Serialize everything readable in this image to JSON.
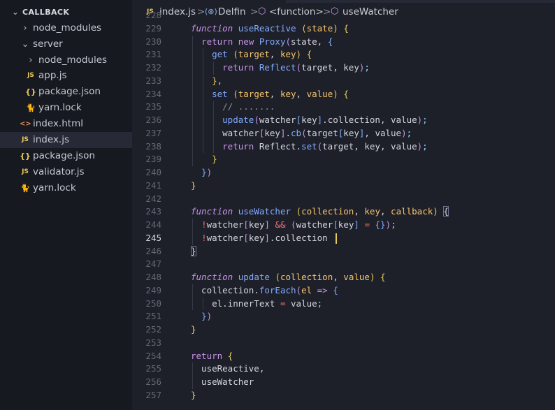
{
  "explorer": {
    "root": "CALLBACK",
    "items": [
      {
        "label": "node_modules",
        "kind": "folder",
        "depth": 1,
        "icon": "chevron-right-icon"
      },
      {
        "label": "server",
        "kind": "folder-open",
        "depth": 1,
        "icon": "chevron-down-icon"
      },
      {
        "label": "node_modules",
        "kind": "folder",
        "depth": 2,
        "icon": "chevron-right-icon"
      },
      {
        "label": "app.js",
        "kind": "js",
        "depth": 2,
        "icon": "js-file-icon"
      },
      {
        "label": "package.json",
        "kind": "json",
        "depth": 2,
        "icon": "json-file-icon"
      },
      {
        "label": "yarn.lock",
        "kind": "yarn",
        "depth": 2,
        "icon": "yarn-file-icon"
      },
      {
        "label": "index.html",
        "kind": "html",
        "depth": 1,
        "icon": "html-file-icon"
      },
      {
        "label": "index.js",
        "kind": "js",
        "depth": 1,
        "icon": "js-file-icon",
        "active": true
      },
      {
        "label": "package.json",
        "kind": "json",
        "depth": 1,
        "icon": "json-file-icon"
      },
      {
        "label": "validator.js",
        "kind": "js",
        "depth": 1,
        "icon": "js-file-icon"
      },
      {
        "label": "yarn.lock",
        "kind": "yarn",
        "depth": 1,
        "icon": "yarn-file-icon"
      }
    ]
  },
  "breadcrumb": {
    "file_badge": "JS",
    "file": "index.js",
    "separator": ">",
    "var": "Delfin",
    "function": "<function>",
    "symbol": "useWatcher"
  },
  "icons": {
    "js_badge": "JS",
    "json_glyph": "{}",
    "html_glyph": "<>",
    "yarn_glyph": "🐈",
    "chevron_right": "›",
    "chevron_down": "⌄",
    "var_glyph": "(⊗)",
    "cube_glyph": "⬡"
  },
  "colors": {
    "keyword": "#c792ea",
    "function": "#82aaff",
    "param": "#f7c46c",
    "operator": "#f07178",
    "punctuation": "#89ddff",
    "text": "#d4d6df",
    "comment": "#8a90a0",
    "line_number": "#636878",
    "cursor": "#e8c95a",
    "sidebar_bg": "#171920",
    "editor_bg": "#1e2029"
  },
  "editor": {
    "current_line": 245,
    "lines": [
      {
        "n": 228,
        "tokens": []
      },
      {
        "n": 229,
        "tokens": [
          [
            "ki",
            "function"
          ],
          [
            "t",
            " "
          ],
          [
            "f",
            "useReactive"
          ],
          [
            "t",
            " "
          ],
          [
            "b1",
            "("
          ],
          [
            "p",
            "state"
          ],
          [
            "b1",
            ")"
          ],
          [
            "t",
            " "
          ],
          [
            "b1",
            "{"
          ]
        ]
      },
      {
        "n": 230,
        "tokens": [
          [
            "t",
            "  "
          ],
          [
            "k",
            "return"
          ],
          [
            "t",
            " "
          ],
          [
            "k",
            "new"
          ],
          [
            "t",
            " "
          ],
          [
            "f",
            "Proxy"
          ],
          [
            "b2",
            "("
          ],
          [
            "t",
            "state, "
          ],
          [
            "b3",
            "{"
          ]
        ]
      },
      {
        "n": 231,
        "tokens": [
          [
            "t",
            "    "
          ],
          [
            "f",
            "get"
          ],
          [
            "t",
            " "
          ],
          [
            "b1",
            "("
          ],
          [
            "p",
            "target"
          ],
          [
            "t",
            ", "
          ],
          [
            "p",
            "key"
          ],
          [
            "b1",
            ")"
          ],
          [
            "t",
            " "
          ],
          [
            "b1",
            "{"
          ]
        ]
      },
      {
        "n": 232,
        "tokens": [
          [
            "t",
            "      "
          ],
          [
            "k",
            "return"
          ],
          [
            "t",
            " "
          ],
          [
            "f",
            "Reflect"
          ],
          [
            "b2",
            "("
          ],
          [
            "t",
            "target, key"
          ],
          [
            "b2",
            ")"
          ],
          [
            "pu",
            ";"
          ]
        ]
      },
      {
        "n": 233,
        "tokens": [
          [
            "t",
            "    "
          ],
          [
            "b1",
            "}"
          ],
          [
            "pu",
            ","
          ]
        ]
      },
      {
        "n": 234,
        "tokens": [
          [
            "t",
            "    "
          ],
          [
            "f",
            "set"
          ],
          [
            "t",
            " "
          ],
          [
            "b1",
            "("
          ],
          [
            "p",
            "target"
          ],
          [
            "t",
            ", "
          ],
          [
            "p",
            "key"
          ],
          [
            "t",
            ", "
          ],
          [
            "p",
            "value"
          ],
          [
            "b1",
            ")"
          ],
          [
            "t",
            " "
          ],
          [
            "b1",
            "{"
          ]
        ]
      },
      {
        "n": 235,
        "tokens": [
          [
            "t",
            "      "
          ],
          [
            "c",
            "// ......."
          ]
        ]
      },
      {
        "n": 236,
        "tokens": [
          [
            "t",
            "      "
          ],
          [
            "f",
            "update"
          ],
          [
            "b2",
            "("
          ],
          [
            "t",
            "watcher"
          ],
          [
            "b3",
            "["
          ],
          [
            "t",
            "key"
          ],
          [
            "b3",
            "]"
          ],
          [
            "t",
            ".collection, value"
          ],
          [
            "b2",
            ")"
          ],
          [
            "pu",
            ";"
          ]
        ]
      },
      {
        "n": 237,
        "tokens": [
          [
            "t",
            "      watcher"
          ],
          [
            "b2",
            "["
          ],
          [
            "t",
            "key"
          ],
          [
            "b2",
            "]"
          ],
          [
            "t",
            "."
          ],
          [
            "f",
            "cb"
          ],
          [
            "b2",
            "("
          ],
          [
            "t",
            "target"
          ],
          [
            "b3",
            "["
          ],
          [
            "t",
            "key"
          ],
          [
            "b3",
            "]"
          ],
          [
            "t",
            ", value"
          ],
          [
            "b2",
            ")"
          ],
          [
            "pu",
            ";"
          ]
        ]
      },
      {
        "n": 238,
        "tokens": [
          [
            "t",
            "      "
          ],
          [
            "k",
            "return"
          ],
          [
            "t",
            " Reflect."
          ],
          [
            "f",
            "set"
          ],
          [
            "b2",
            "("
          ],
          [
            "t",
            "target, key, value"
          ],
          [
            "b2",
            ")"
          ],
          [
            "pu",
            ";"
          ]
        ]
      },
      {
        "n": 239,
        "tokens": [
          [
            "t",
            "    "
          ],
          [
            "b1",
            "}"
          ]
        ]
      },
      {
        "n": 240,
        "tokens": [
          [
            "t",
            "  "
          ],
          [
            "b3",
            "}"
          ],
          [
            "b2",
            ")"
          ]
        ]
      },
      {
        "n": 241,
        "tokens": [
          [
            "b1",
            "}"
          ]
        ]
      },
      {
        "n": 242,
        "tokens": []
      },
      {
        "n": 243,
        "tokens": [
          [
            "ki",
            "function"
          ],
          [
            "t",
            " "
          ],
          [
            "f",
            "useWatcher"
          ],
          [
            "t",
            " "
          ],
          [
            "b1",
            "("
          ],
          [
            "p",
            "collection"
          ],
          [
            "t",
            ", "
          ],
          [
            "p",
            "key"
          ],
          [
            "t",
            ", "
          ],
          [
            "p",
            "callback"
          ],
          [
            "b1",
            ")"
          ],
          [
            "t",
            " "
          ],
          [
            "hb",
            "{"
          ]
        ]
      },
      {
        "n": 244,
        "tokens": [
          [
            "t",
            "  "
          ],
          [
            "op",
            "!"
          ],
          [
            "t",
            "watcher"
          ],
          [
            "b2",
            "["
          ],
          [
            "t",
            "key"
          ],
          [
            "b2",
            "]"
          ],
          [
            "t",
            " "
          ],
          [
            "op",
            "&&"
          ],
          [
            "t",
            " "
          ],
          [
            "b2",
            "("
          ],
          [
            "t",
            "watcher"
          ],
          [
            "b3",
            "["
          ],
          [
            "t",
            "key"
          ],
          [
            "b3",
            "]"
          ],
          [
            "t",
            " "
          ],
          [
            "op",
            "="
          ],
          [
            "t",
            " "
          ],
          [
            "b3",
            "{}"
          ],
          [
            "b2",
            ")"
          ],
          [
            "pu",
            ";"
          ]
        ]
      },
      {
        "n": 245,
        "tokens": [
          [
            "t",
            "  "
          ],
          [
            "op",
            "!"
          ],
          [
            "t",
            "watcher"
          ],
          [
            "b2",
            "["
          ],
          [
            "t",
            "key"
          ],
          [
            "b2",
            "]"
          ],
          [
            "t",
            ".collection "
          ]
        ]
      },
      {
        "n": 246,
        "tokens": [
          [
            "hb",
            "}"
          ]
        ]
      },
      {
        "n": 247,
        "tokens": []
      },
      {
        "n": 248,
        "tokens": [
          [
            "ki",
            "function"
          ],
          [
            "t",
            " "
          ],
          [
            "f",
            "update"
          ],
          [
            "t",
            " "
          ],
          [
            "b1",
            "("
          ],
          [
            "p",
            "collection"
          ],
          [
            "t",
            ", "
          ],
          [
            "p",
            "value"
          ],
          [
            "b1",
            ")"
          ],
          [
            "t",
            " "
          ],
          [
            "b1",
            "{"
          ]
        ]
      },
      {
        "n": 249,
        "tokens": [
          [
            "t",
            "  collection."
          ],
          [
            "f",
            "forEach"
          ],
          [
            "b2",
            "("
          ],
          [
            "p",
            "el"
          ],
          [
            "t",
            " "
          ],
          [
            "k",
            "=>"
          ],
          [
            "t",
            " "
          ],
          [
            "b3",
            "{"
          ]
        ]
      },
      {
        "n": 250,
        "tokens": [
          [
            "t",
            "    el.innerText "
          ],
          [
            "op",
            "="
          ],
          [
            "t",
            " value"
          ],
          [
            "pu",
            ";"
          ]
        ]
      },
      {
        "n": 251,
        "tokens": [
          [
            "t",
            "  "
          ],
          [
            "b3",
            "}"
          ],
          [
            "b2",
            ")"
          ]
        ]
      },
      {
        "n": 252,
        "tokens": [
          [
            "b1",
            "}"
          ]
        ]
      },
      {
        "n": 253,
        "tokens": []
      },
      {
        "n": 254,
        "tokens": [
          [
            "k",
            "return"
          ],
          [
            "t",
            " "
          ],
          [
            "b1",
            "{"
          ]
        ]
      },
      {
        "n": 255,
        "tokens": [
          [
            "t",
            "  useReactive,"
          ]
        ]
      },
      {
        "n": 256,
        "tokens": [
          [
            "t",
            "  useWatcher"
          ]
        ]
      },
      {
        "n": 257,
        "tokens": [
          [
            "b1",
            "}"
          ]
        ]
      }
    ]
  }
}
